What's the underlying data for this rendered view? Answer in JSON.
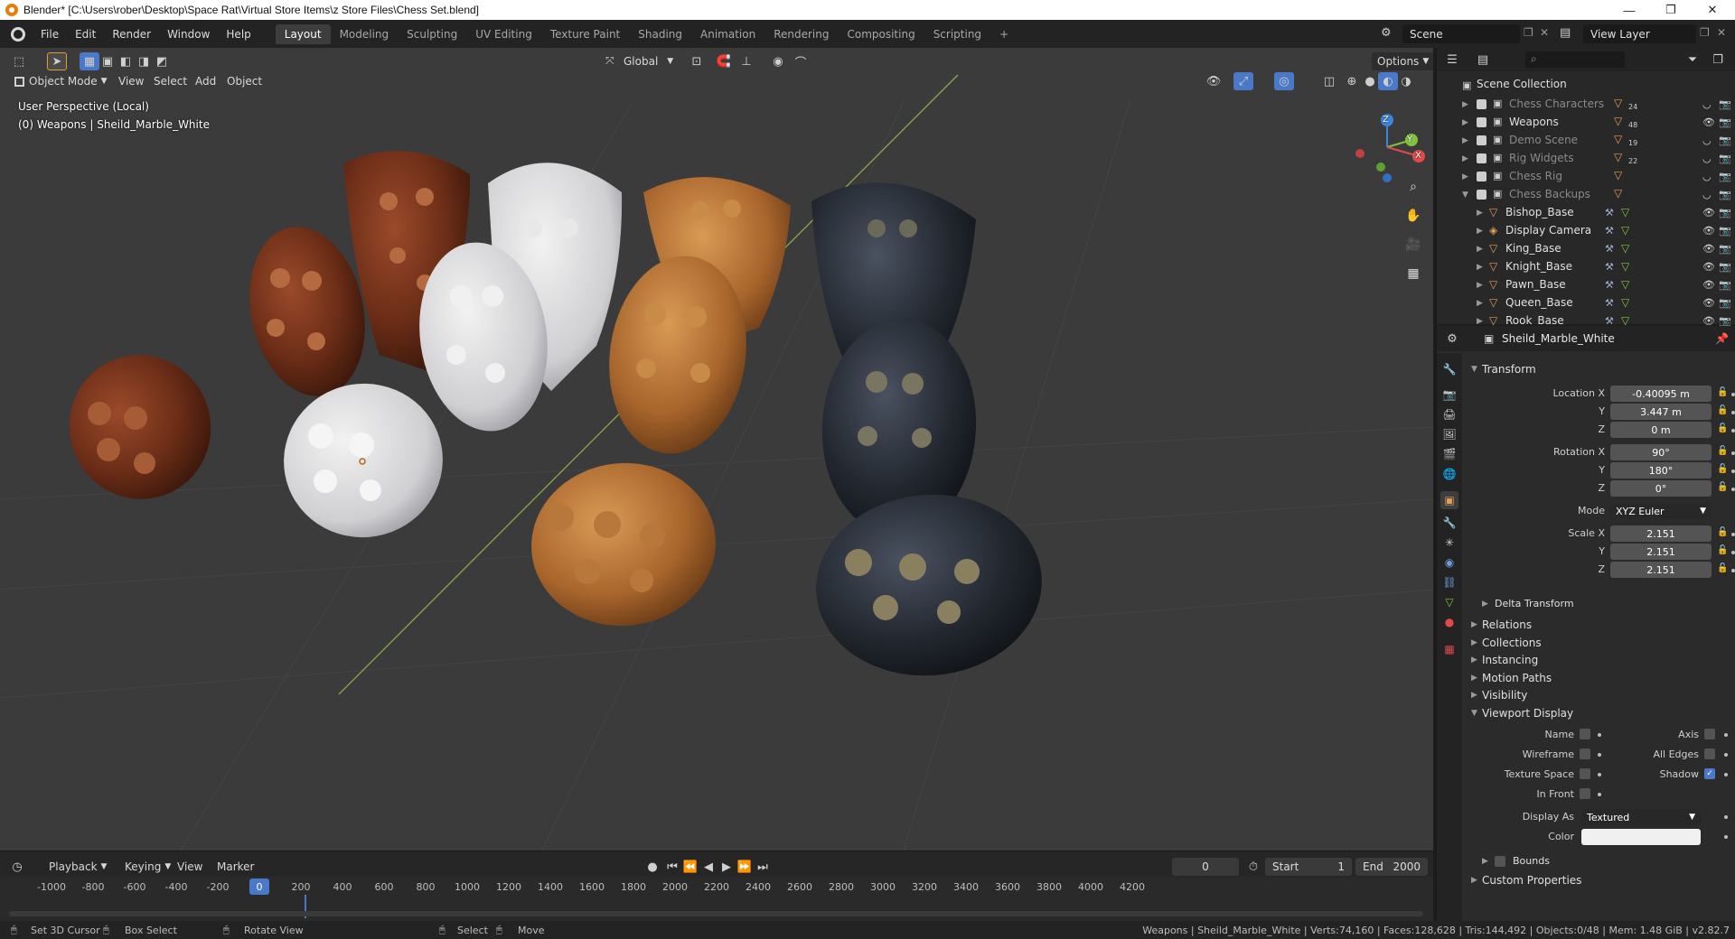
{
  "window": {
    "title": "Blender* [C:\\Users\\rober\\Desktop\\Space Rat\\Virtual Store Items\\z Store Files\\Chess Set.blend]",
    "minimize": "—",
    "maximize": "❐",
    "close": "✕"
  },
  "menu": [
    "File",
    "Edit",
    "Render",
    "Window",
    "Help"
  ],
  "workspaces": [
    "Layout",
    "Modeling",
    "Sculpting",
    "UV Editing",
    "Texture Paint",
    "Shading",
    "Animation",
    "Rendering",
    "Compositing",
    "Scripting"
  ],
  "add_workspace": "+",
  "scene": {
    "label": "Scene",
    "view_layer": "View Layer"
  },
  "viewport": {
    "mode": "Object Mode",
    "menus": [
      "View",
      "Select",
      "Add",
      "Object"
    ],
    "orientation": "Global",
    "options": "Options",
    "overlay_line1": "User Perspective (Local)",
    "overlay_line2": "(0) Weapons | Sheild_Marble_White",
    "gizmo": {
      "x": "X",
      "y": "Y",
      "z": "Z"
    }
  },
  "timeline": {
    "menus": [
      "Playback",
      "Keying",
      "View",
      "Marker"
    ],
    "current_frame": "0",
    "start_label": "Start",
    "start": "1",
    "end_label": "End",
    "end": "2000",
    "ruler": [
      "-1000",
      "-800",
      "-600",
      "-400",
      "-200",
      "0",
      "200",
      "400",
      "600",
      "800",
      "1000",
      "1200",
      "1400",
      "1600",
      "1800",
      "2000",
      "2200",
      "2400",
      "2600",
      "2800",
      "3000",
      "3200",
      "3400",
      "3600",
      "3800",
      "4000",
      "4200"
    ]
  },
  "statusbar": {
    "cursor": "Set 3D Cursor",
    "box_select": "Box Select",
    "rotate": "Rotate View",
    "select": "Select",
    "move": "Move",
    "stats": "Weapons | Sheild_Marble_White | Verts:74,160 | Faces:128,628 | Tris:144,492 | Objects:0/48 | Mem: 1.48 GiB | v2.82.7"
  },
  "outliner": {
    "root": "Scene Collection",
    "collections": [
      {
        "name": "Chess Characters",
        "count": "24",
        "active": false
      },
      {
        "name": "Weapons",
        "count": "48",
        "active": true
      },
      {
        "name": "Demo Scene",
        "count": "19",
        "active": false
      },
      {
        "name": "Rig Widgets",
        "count": "22",
        "active": false
      },
      {
        "name": "Chess Rig",
        "count": "",
        "active": false
      },
      {
        "name": "Chess Backups",
        "count": "",
        "active": false
      }
    ],
    "objects": [
      "Bishop_Base",
      "Display Camera",
      "King_Base",
      "Knight_Base",
      "Pawn_Base",
      "Queen_Base",
      "Rook_Base"
    ]
  },
  "properties": {
    "object_name": "Sheild_Marble_White",
    "transform": {
      "header": "Transform",
      "location_label": "Location X",
      "location": [
        "-0.40095 m",
        "3.447 m",
        "0 m"
      ],
      "rotation_label": "Rotation X",
      "rotation": [
        "90°",
        "180°",
        "0°"
      ],
      "mode_label": "Mode",
      "mode": "XYZ Euler",
      "scale_label": "Scale X",
      "scale": [
        "2.151",
        "2.151",
        "2.151"
      ],
      "axis_y": "Y",
      "axis_z": "Z",
      "delta": "Delta Transform"
    },
    "sections": [
      "Relations",
      "Collections",
      "Instancing",
      "Motion Paths",
      "Visibility"
    ],
    "viewport_display": {
      "header": "Viewport Display",
      "name": "Name",
      "axis": "Axis",
      "wireframe": "Wireframe",
      "all_edges": "All Edges",
      "texture_space": "Texture Space",
      "shadow": "Shadow",
      "in_front": "In Front",
      "display_as_label": "Display As",
      "display_as": "Textured",
      "color_label": "Color",
      "bounds": "Bounds"
    },
    "custom_properties": "Custom Properties"
  },
  "colors": {
    "accent": "#4a79c7",
    "object_orange": "#e59d53",
    "gizmo_x": "#e04a4a",
    "gizmo_y": "#7fc43a",
    "gizmo_z": "#3a85e0"
  }
}
